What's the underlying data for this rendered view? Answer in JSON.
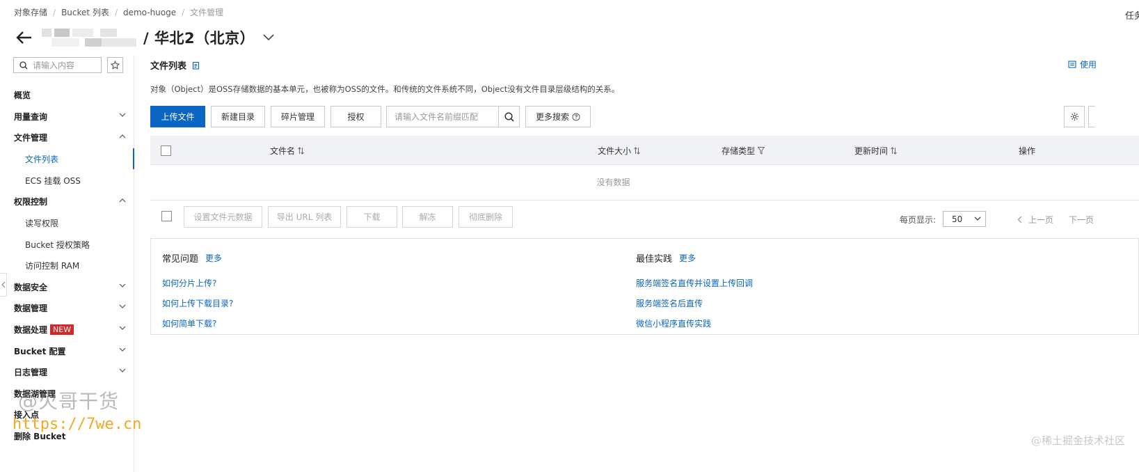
{
  "breadcrumb": [
    "对象存储",
    "Bucket 列表",
    "demo-huoge",
    "文件管理"
  ],
  "top_right": "任务",
  "header": {
    "title": "/ 华北2（北京）"
  },
  "sidebar": {
    "search_placeholder": "请输入内容",
    "items": [
      {
        "label": "概览"
      },
      {
        "label": "用量查询"
      },
      {
        "label": "文件管理"
      },
      {
        "label": "文件列表"
      },
      {
        "label": "ECS 挂载 OSS"
      },
      {
        "label": "权限控制"
      },
      {
        "label": "读写权限"
      },
      {
        "label": "Bucket 授权策略"
      },
      {
        "label": "访问控制 RAM"
      },
      {
        "label": "数据安全"
      },
      {
        "label": "数据管理"
      },
      {
        "label": "数据处理",
        "badge": "NEW"
      },
      {
        "label": "Bucket 配置"
      },
      {
        "label": "日志管理"
      },
      {
        "label": "数据湖管理"
      },
      {
        "label": "接入点"
      },
      {
        "label": "删除 Bucket"
      }
    ]
  },
  "main": {
    "title": "文件列表",
    "help_link": "使用",
    "description": "对象（Object）是OSS存储数据的基本单元，也被称为OSS的文件。和传统的文件系统不同，Object没有文件目录层级结构的关系。",
    "toolbar": {
      "upload": "上传文件",
      "new_dir": "新建目录",
      "fragments": "碎片管理",
      "authorize": "授权",
      "search_placeholder": "请输入文件名前缀匹配",
      "more_search": "更多搜索"
    },
    "table": {
      "columns": [
        "文件名",
        "文件大小",
        "存储类型",
        "更新时间",
        "操作"
      ],
      "empty_text": "没有数据"
    },
    "bulk_actions": [
      "设置文件元数据",
      "导出 URL 列表",
      "下载",
      "解冻",
      "彻底删除"
    ],
    "pagination": {
      "per_page_label": "每页显示:",
      "per_page_value": "50",
      "prev": "上一页",
      "next": "下一页"
    },
    "faq": {
      "title": "常见问题",
      "more": "更多",
      "links": [
        "如何分片上传?",
        "如何上传下载目录?",
        "如何简单下载?"
      ]
    },
    "best_practice": {
      "title": "最佳实践",
      "more": "更多",
      "links": [
        "服务端签名直传并设置上传回调",
        "服务端签名后直传",
        "微信小程序直传实践"
      ]
    }
  },
  "watermarks": {
    "author": "@火哥干货",
    "url": "https://7we.cn",
    "site": "@稀土掘金技术社区"
  },
  "colors": {
    "accent": "#0a66c2",
    "badge": "#d12a2a"
  }
}
